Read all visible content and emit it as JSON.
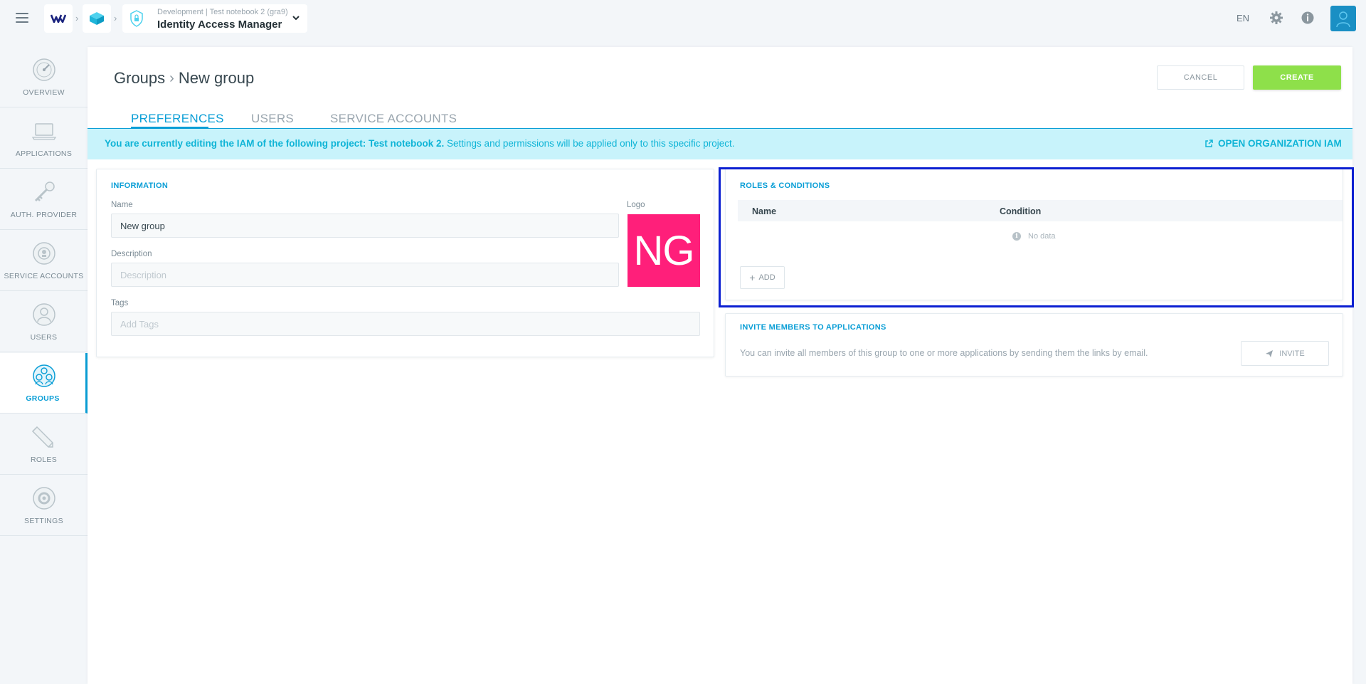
{
  "topbar": {
    "project_env": "Development",
    "project_name_sub": "Test notebook 2 (gra9)",
    "app_title": "Identity Access Manager",
    "language": "EN"
  },
  "sidebar": {
    "items": [
      {
        "label": "OVERVIEW",
        "icon": "speedometer-icon"
      },
      {
        "label": "APPLICATIONS",
        "icon": "laptop-icon"
      },
      {
        "label": "AUTH. PROVIDER",
        "icon": "key-icon"
      },
      {
        "label": "SERVICE ACCOUNTS",
        "icon": "service-account-icon"
      },
      {
        "label": "USERS",
        "icon": "user-icon"
      },
      {
        "label": "GROUPS",
        "icon": "group-icon",
        "active": true
      },
      {
        "label": "ROLES",
        "icon": "pencil-icon"
      },
      {
        "label": "SETTINGS",
        "icon": "gear-icon"
      }
    ]
  },
  "header": {
    "breadcrumb_parent": "Groups",
    "breadcrumb_current": "New group",
    "cancel_label": "CANCEL",
    "create_label": "CREATE"
  },
  "tabs": [
    {
      "label": "PREFERENCES",
      "active": true
    },
    {
      "label": "USERS",
      "active": false
    },
    {
      "label": "SERVICE ACCOUNTS",
      "active": false
    }
  ],
  "banner": {
    "bold_text": "You are currently editing the IAM of the following project: Test notebook 2.",
    "text": " Settings and permissions will be applied only to this specific project.",
    "link_label": "OPEN ORGANIZATION IAM"
  },
  "information": {
    "title": "INFORMATION",
    "name_label": "Name",
    "name_value": "New group",
    "description_label": "Description",
    "description_placeholder": "Description",
    "tags_label": "Tags",
    "tags_placeholder": "Add Tags",
    "logo_label": "Logo",
    "logo_initials": "NG"
  },
  "roles": {
    "title": "ROLES & CONDITIONS",
    "columns": [
      "Name",
      "Condition"
    ],
    "empty_text": "No data",
    "add_label": "ADD"
  },
  "invite": {
    "title": "INVITE MEMBERS TO APPLICATIONS",
    "description": "You can invite all members of this group to one or more applications by sending them the links by email.",
    "button_label": "INVITE"
  },
  "colors": {
    "accent": "#0a9ed6",
    "create_green": "#8ee04a",
    "banner_bg": "#c8f3fb",
    "logo_bg": "#ff1f7a",
    "highlight_border": "#0b1fd1"
  }
}
